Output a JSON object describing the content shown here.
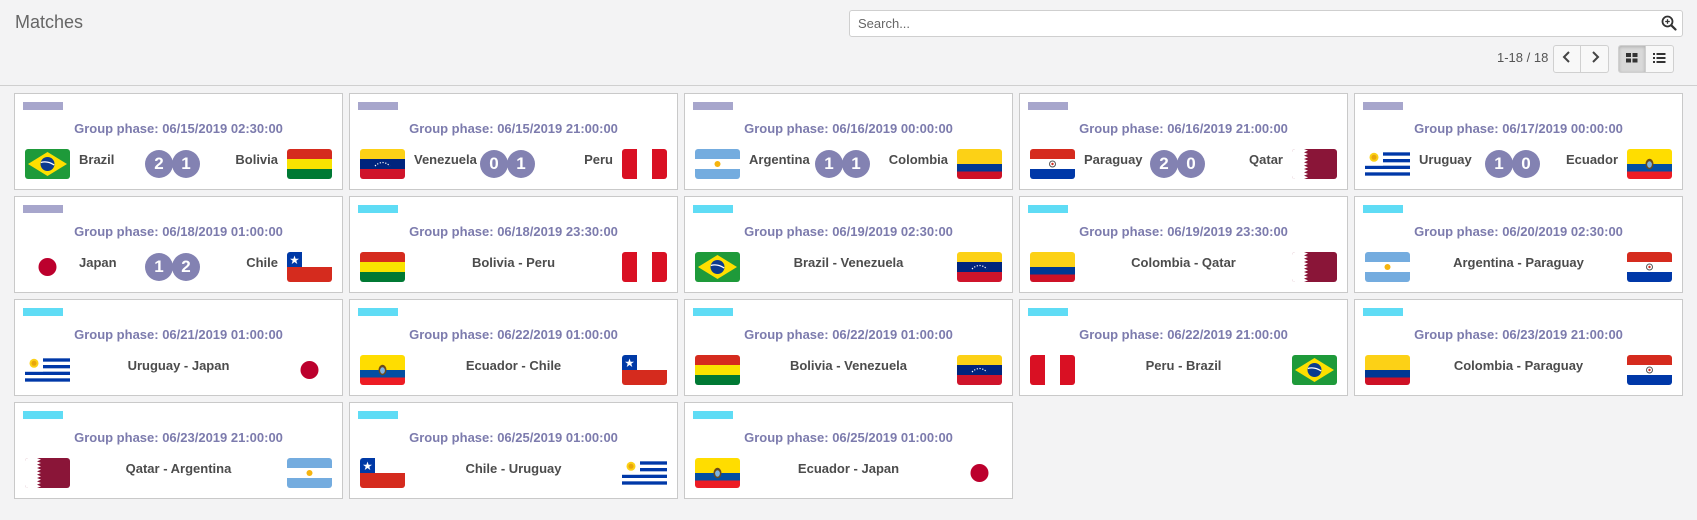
{
  "page": {
    "title": "Matches"
  },
  "search": {
    "placeholder": "Search...",
    "value": ""
  },
  "pager": {
    "range": "1-18 / 18"
  },
  "colors": {
    "tag_played": "#a7a6cc",
    "tag_upcoming": "#5fdcf5",
    "score_bg": "#8382b2",
    "date_text": "#7c7bad"
  },
  "icons": {
    "search": "search-zoom-icon",
    "prev": "chevron-left-icon",
    "next": "chevron-right-icon",
    "kanban": "kanban-view-icon",
    "list": "list-view-icon"
  },
  "matches": [
    {
      "when": "Group phase: 06/15/2019 02:30:00",
      "status": "played",
      "home": "Brazil",
      "away": "Bolivia",
      "home_flag": "brazil-flag-icon",
      "away_flag": "bolivia-flag-icon",
      "home_goals": "2",
      "away_goals": "1"
    },
    {
      "when": "Group phase: 06/15/2019 21:00:00",
      "status": "played",
      "home": "Venezuela",
      "away": "Peru",
      "home_flag": "venezuela-flag-icon",
      "away_flag": "peru-flag-icon",
      "home_goals": "0",
      "away_goals": "1"
    },
    {
      "when": "Group phase: 06/16/2019 00:00:00",
      "status": "played",
      "home": "Argentina",
      "away": "Colombia",
      "home_flag": "argentina-flag-icon",
      "away_flag": "colombia-flag-icon",
      "home_goals": "1",
      "away_goals": "1"
    },
    {
      "when": "Group phase: 06/16/2019 21:00:00",
      "status": "played",
      "home": "Paraguay",
      "away": "Qatar",
      "home_flag": "paraguay-flag-icon",
      "away_flag": "qatar-flag-icon",
      "home_goals": "2",
      "away_goals": "0"
    },
    {
      "when": "Group phase: 06/17/2019 00:00:00",
      "status": "played",
      "home": "Uruguay",
      "away": "Ecuador",
      "home_flag": "uruguay-flag-icon",
      "away_flag": "ecuador-flag-icon",
      "home_goals": "1",
      "away_goals": "0"
    },
    {
      "when": "Group phase: 06/18/2019 01:00:00",
      "status": "played",
      "home": "Japan",
      "away": "Chile",
      "home_flag": "japan-flag-icon",
      "away_flag": "chile-flag-icon",
      "home_goals": "1",
      "away_goals": "2"
    },
    {
      "when": "Group phase: 06/18/2019 23:30:00",
      "status": "upcoming",
      "pairing": "Bolivia - Peru",
      "home_flag": "bolivia-flag-icon",
      "away_flag": "peru-flag-icon"
    },
    {
      "when": "Group phase: 06/19/2019 02:30:00",
      "status": "upcoming",
      "pairing": "Brazil - Venezuela",
      "home_flag": "brazil-flag-icon",
      "away_flag": "venezuela-flag-icon"
    },
    {
      "when": "Group phase: 06/19/2019 23:30:00",
      "status": "upcoming",
      "pairing": "Colombia - Qatar",
      "home_flag": "colombia-flag-icon",
      "away_flag": "qatar-flag-icon"
    },
    {
      "when": "Group phase: 06/20/2019 02:30:00",
      "status": "upcoming",
      "pairing": "Argentina - Paraguay",
      "home_flag": "argentina-flag-icon",
      "away_flag": "paraguay-flag-icon"
    },
    {
      "when": "Group phase: 06/21/2019 01:00:00",
      "status": "upcoming",
      "pairing": "Uruguay - Japan",
      "home_flag": "uruguay-flag-icon",
      "away_flag": "japan-flag-icon"
    },
    {
      "when": "Group phase: 06/22/2019 01:00:00",
      "status": "upcoming",
      "pairing": "Ecuador - Chile",
      "home_flag": "ecuador-flag-icon",
      "away_flag": "chile-flag-icon"
    },
    {
      "when": "Group phase: 06/22/2019 01:00:00",
      "status": "upcoming",
      "pairing": "Bolivia - Venezuela",
      "home_flag": "bolivia-flag-icon",
      "away_flag": "venezuela-flag-icon"
    },
    {
      "when": "Group phase: 06/22/2019 21:00:00",
      "status": "upcoming",
      "pairing": "Peru - Brazil",
      "home_flag": "peru-flag-icon",
      "away_flag": "brazil-flag-icon"
    },
    {
      "when": "Group phase: 06/23/2019 21:00:00",
      "status": "upcoming",
      "pairing": "Colombia - Paraguay",
      "home_flag": "colombia-flag-icon",
      "away_flag": "paraguay-flag-icon"
    },
    {
      "when": "Group phase: 06/23/2019 21:00:00",
      "status": "upcoming",
      "pairing": "Qatar - Argentina",
      "home_flag": "qatar-flag-icon",
      "away_flag": "argentina-flag-icon"
    },
    {
      "when": "Group phase: 06/25/2019 01:00:00",
      "status": "upcoming",
      "pairing": "Chile - Uruguay",
      "home_flag": "chile-flag-icon",
      "away_flag": "uruguay-flag-icon"
    },
    {
      "when": "Group phase: 06/25/2019 01:00:00",
      "status": "upcoming",
      "pairing": "Ecuador - Japan",
      "home_flag": "ecuador-flag-icon",
      "away_flag": "japan-flag-icon"
    }
  ]
}
